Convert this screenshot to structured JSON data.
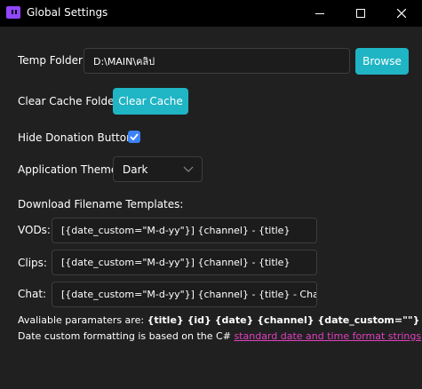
{
  "window": {
    "title": "Global Settings",
    "icon": "twitch-downloader-icon"
  },
  "temp_folder": {
    "label": "Temp Folder:",
    "value": "D:\\MAIN\\คลิป",
    "browse_label": "Browse"
  },
  "cache": {
    "label": "Clear Cache Folder:",
    "button_label": "Clear Cache"
  },
  "donation": {
    "label": "Hide Donation Button:",
    "checked": true
  },
  "theme": {
    "label": "Application Theme:",
    "selected": "Dark"
  },
  "templates": {
    "heading": "Download Filename Templates:",
    "vods_label": "VODs:",
    "vods_value": "[{date_custom=\"M-d-yy\"}] {channel} - {title}",
    "clips_label": "Clips:",
    "clips_value": "[{date_custom=\"M-d-yy\"}] {channel} - {title}",
    "chat_label": "Chat:",
    "chat_value": "[{date_custom=\"M-d-yy\"}] {channel} - {title} - Chat"
  },
  "info": {
    "params_prefix": "Avaliable paramaters are: ",
    "params_list": "{title} {id} {date} {channel} {date_custom=\"\"}",
    "date_prefix": "Date custom formatting is based on the C# ",
    "date_link": "standard date and time format strings"
  },
  "colors": {
    "accent": "#1fb5c5",
    "checkbox": "#3b82f6",
    "link": "#e040c0",
    "background": "#202020"
  }
}
